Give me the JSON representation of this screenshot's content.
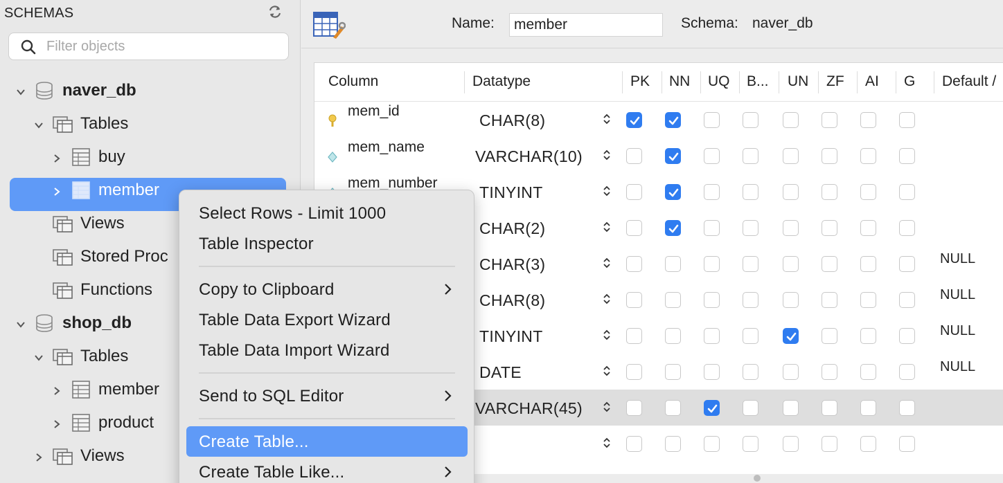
{
  "sidebar": {
    "header": "SCHEMAS",
    "filter_placeholder": "Filter objects",
    "tree": [
      {
        "label": "naver_db",
        "kind": "database"
      },
      {
        "label": "Tables",
        "kind": "folder"
      },
      {
        "label": "buy",
        "kind": "table"
      },
      {
        "label": "member",
        "kind": "table",
        "selected": true
      },
      {
        "label": "Views",
        "kind": "folder"
      },
      {
        "label": "Stored Proc",
        "kind": "folder"
      },
      {
        "label": "Functions",
        "kind": "folder"
      },
      {
        "label": "shop_db",
        "kind": "database"
      },
      {
        "label": "Tables",
        "kind": "folder"
      },
      {
        "label": "member",
        "kind": "table"
      },
      {
        "label": "product",
        "kind": "table"
      },
      {
        "label": "Views",
        "kind": "folder"
      }
    ]
  },
  "editor": {
    "name_label": "Name:",
    "name_value": "member",
    "schema_label": "Schema:",
    "schema_value": "naver_db",
    "columns_header": [
      "Column",
      "Datatype",
      "PK",
      "NN",
      "UQ",
      "B...",
      "UN",
      "ZF",
      "AI",
      "G",
      "Default /"
    ],
    "rows": [
      {
        "name": "mem_id",
        "type": "CHAR(8)",
        "icon": "key-icon",
        "flags": [
          true,
          true,
          false,
          false,
          false,
          false,
          false,
          false
        ],
        "default": ""
      },
      {
        "name": "mem_name",
        "type": "VARCHAR(10)",
        "icon": "column-diamond-icon",
        "flags": [
          false,
          true,
          false,
          false,
          false,
          false,
          false,
          false
        ],
        "default": ""
      },
      {
        "name": "mem_number",
        "type": "TINYINT",
        "icon": "column-diamond-icon",
        "flags": [
          false,
          true,
          false,
          false,
          false,
          false,
          false,
          false
        ],
        "default": ""
      },
      {
        "name": "",
        "type": "CHAR(2)",
        "icon": "",
        "flags": [
          false,
          true,
          false,
          false,
          false,
          false,
          false,
          false
        ],
        "default": ""
      },
      {
        "name": "",
        "type": "CHAR(3)",
        "icon": "",
        "flags": [
          false,
          false,
          false,
          false,
          false,
          false,
          false,
          false
        ],
        "default": "NULL"
      },
      {
        "name": "",
        "type": "CHAR(8)",
        "icon": "",
        "flags": [
          false,
          false,
          false,
          false,
          false,
          false,
          false,
          false
        ],
        "default": "NULL"
      },
      {
        "name": "",
        "type": "TINYINT",
        "icon": "",
        "flags": [
          false,
          false,
          false,
          false,
          true,
          false,
          false,
          false
        ],
        "default": "NULL"
      },
      {
        "name": "",
        "type": "DATE",
        "icon": "",
        "flags": [
          false,
          false,
          false,
          false,
          false,
          false,
          false,
          false
        ],
        "default": "NULL"
      },
      {
        "name": "",
        "type": "VARCHAR(45)",
        "icon": "",
        "flags": [
          false,
          false,
          true,
          false,
          false,
          false,
          false,
          false
        ],
        "default": "",
        "highlighted": true
      },
      {
        "name": "",
        "type": "",
        "icon": "",
        "flags": [
          false,
          false,
          false,
          false,
          false,
          false,
          false,
          false
        ],
        "default": ""
      }
    ]
  },
  "context_menu": {
    "items": [
      {
        "label": "Select Rows - Limit 1000",
        "submenu": false
      },
      {
        "label": "Table Inspector",
        "submenu": false
      },
      {
        "separator": true
      },
      {
        "label": "Copy to Clipboard",
        "submenu": true
      },
      {
        "label": "Table Data Export Wizard",
        "submenu": false
      },
      {
        "label": "Table Data Import Wizard",
        "submenu": false
      },
      {
        "separator": true
      },
      {
        "label": "Send to SQL Editor",
        "submenu": true
      },
      {
        "separator": true
      },
      {
        "label": "Create Table...",
        "submenu": false,
        "active": true
      },
      {
        "label": "Create Table Like...",
        "submenu": true
      }
    ]
  },
  "colors": {
    "selection": "#5f9af7",
    "checkbox_on": "#2f7cf0",
    "sidebar_bg": "#e8e8e8"
  }
}
